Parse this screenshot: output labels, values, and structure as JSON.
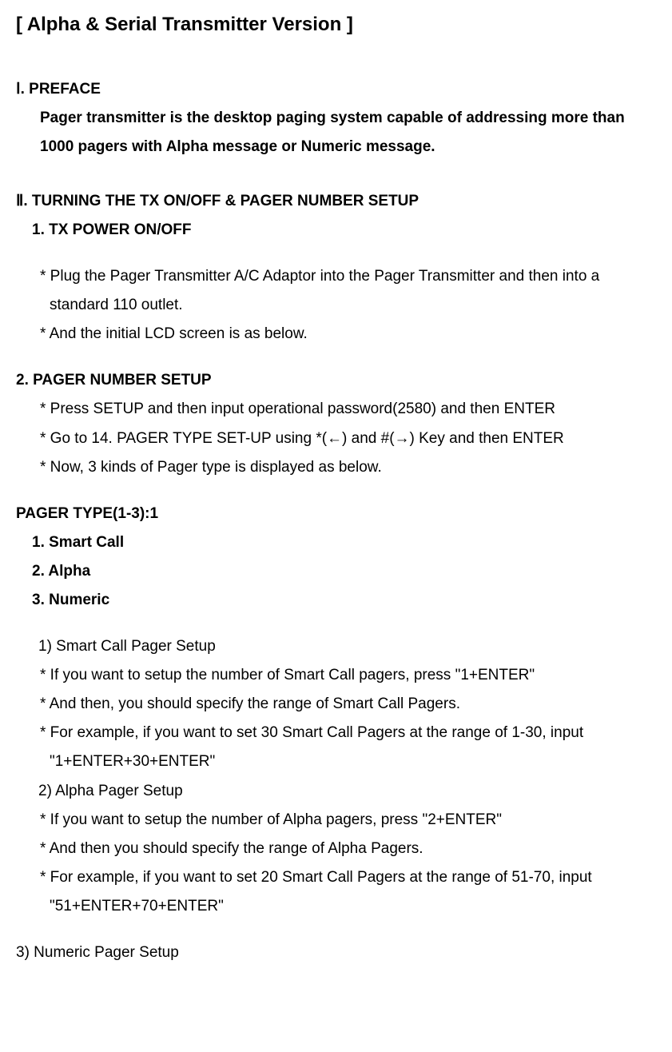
{
  "title": "[ Alpha & Serial Transmitter Version ]",
  "sections": {
    "preface_heading": "Ⅰ. PREFACE",
    "preface_body": "Pager transmitter is the desktop paging system capable of addressing more than 1000 pagers with Alpha message or Numeric message.",
    "sec2_heading": "Ⅱ. TURNING THE TX ON/OFF & PAGER NUMBER SETUP",
    "sub1_heading": "1. TX POWER ON/OFF",
    "sub1_line1": "* Plug the Pager Transmitter A/C Adaptor into the Pager Transmitter and then into a standard 110 outlet.",
    "sub1_line2": "* And the initial LCD screen is as below.",
    "sub2_heading": "2. PAGER NUMBER SETUP",
    "sub2_lines": [
      "* Press SETUP and then input operational password(2580) and then ENTER",
      "* Go to 14. PAGER TYPE SET-UP using *(←) and #(→) Key and then ENTER",
      "* Now, 3 kinds of Pager type is displayed as below."
    ],
    "pager_type_heading": "PAGER TYPE(1-3):1",
    "pager_types": [
      "1. Smart Call",
      "2. Alpha",
      "3. Numeric"
    ],
    "setup1_title": "1) Smart Call Pager Setup",
    "setup1_lines": [
      "* If you want to setup the number of Smart Call pagers, press \"1+ENTER\"",
      "* And then, you should specify the range of Smart Call Pagers.",
      "* For example, if you want to set 30 Smart Call Pagers at the range of 1-30, input \"1+ENTER+30+ENTER\""
    ],
    "setup2_title": "2) Alpha Pager Setup",
    "setup2_lines": [
      "* If you want to setup the number of Alpha pagers, press \"2+ENTER\"",
      "* And then you should specify the range of Alpha Pagers.",
      "* For example, if you want to set 20 Smart Call Pagers at the range of 51-70, input \"51+ENTER+70+ENTER\""
    ],
    "setup3_title": "3) Numeric Pager Setup"
  }
}
